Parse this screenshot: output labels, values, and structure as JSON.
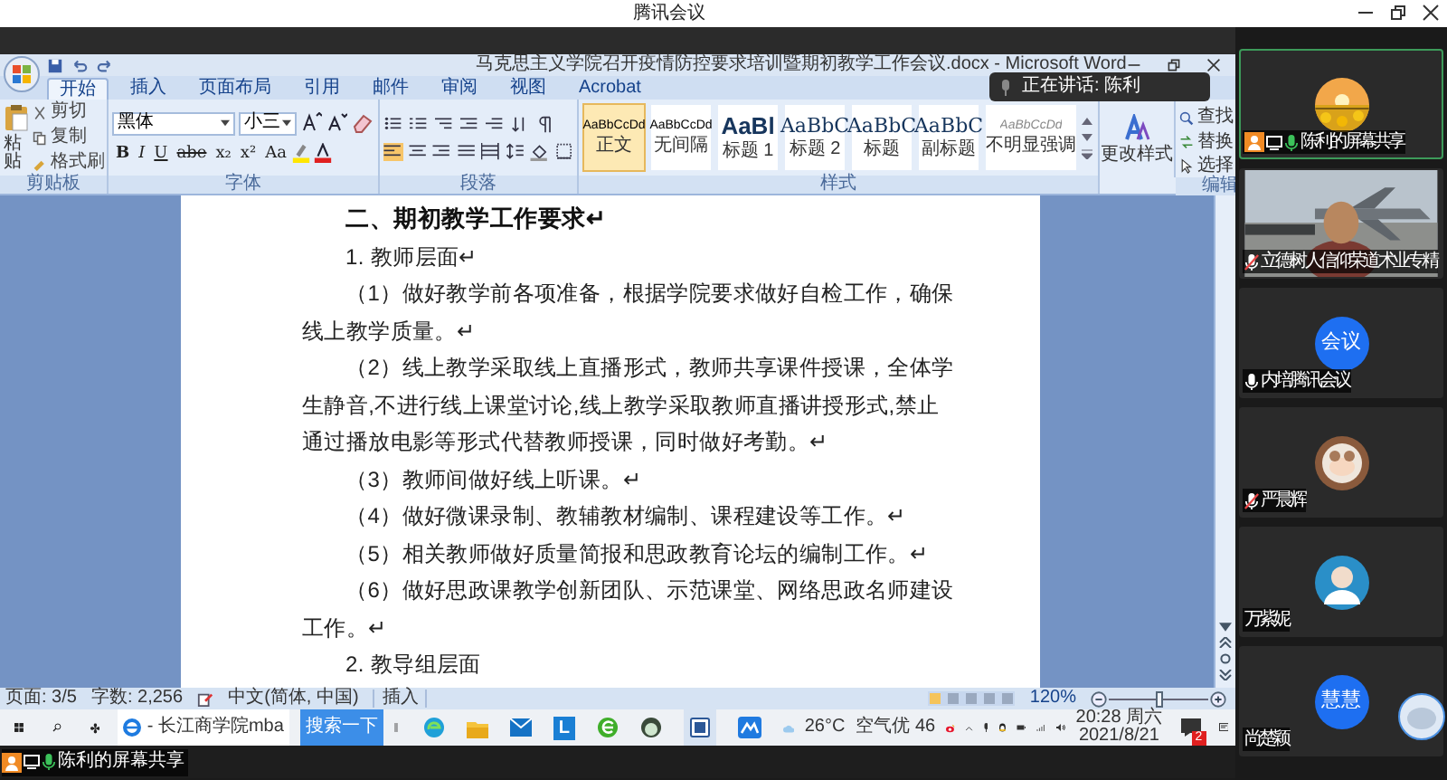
{
  "meeting": {
    "title": "腾讯会议"
  },
  "word": {
    "title": "马克思主义学院召开疫情防控要求培训暨期初教学工作会议.docx - Microsoft Word",
    "tabs": [
      {
        "label": "开始",
        "selected": true
      },
      {
        "label": "插入",
        "selected": false
      },
      {
        "label": "页面布局",
        "selected": false
      },
      {
        "label": "引用",
        "selected": false
      },
      {
        "label": "邮件",
        "selected": false
      },
      {
        "label": "审阅",
        "selected": false
      },
      {
        "label": "视图",
        "selected": false
      },
      {
        "label": "Acrobat",
        "selected": false
      }
    ],
    "clipboard": {
      "paste": "粘贴",
      "items": [
        "剪切",
        "复制",
        "格式刷"
      ],
      "group": "剪贴板"
    },
    "font": {
      "name": "黑体",
      "size": "小三",
      "buttons": [
        "B",
        "I",
        "U",
        "abe",
        "x₂",
        "x²",
        "Aa"
      ],
      "group": "字体"
    },
    "paragraph": {
      "group": "段落"
    },
    "styles": {
      "items": [
        {
          "sample": "AaBbCcDd",
          "label": "正文",
          "selected": true
        },
        {
          "sample": "AaBbCcDd",
          "label": "无间隔",
          "selected": false
        },
        {
          "sample": "AaBl",
          "label": "标题 1",
          "selected": false
        },
        {
          "sample": "AaBbC",
          "label": "标题 2",
          "selected": false
        },
        {
          "sample": "AaBbC",
          "label": "标题",
          "selected": false
        },
        {
          "sample": "AaBbC",
          "label": "副标题",
          "selected": false
        },
        {
          "sample": "AaBbCcDd",
          "label": "不明显强调",
          "selected": false
        }
      ],
      "change": "更改样式",
      "group": "样式"
    },
    "editing": {
      "items": [
        "查找",
        "替换",
        "选择"
      ],
      "group": "编辑"
    },
    "document": {
      "paragraphs": [
        {
          "kind": "heading",
          "text": "二、期初教学工作要求↵"
        },
        {
          "kind": "body",
          "text": "1. 教师层面↵"
        },
        {
          "kind": "body",
          "text": "（1）做好教学前各项准备，根据学院要求做好自检工作，确保线上教学质量。↵"
        },
        {
          "kind": "body",
          "text": "（2）线上教学采取线上直播形式，教师共享课件授课，全体学生静音,不进行线上课堂讨论,线上教学采取教师直播讲授形式,禁止通过播放电影等形式代替教师授课，同时做好考勤。↵"
        },
        {
          "kind": "body",
          "text": "（3）教师间做好线上听课。↵"
        },
        {
          "kind": "body",
          "text": "（4）做好微课录制、教辅教材编制、课程建设等工作。↵"
        },
        {
          "kind": "body",
          "text": "（5）相关教师做好质量简报和思政教育论坛的编制工作。↵"
        },
        {
          "kind": "body",
          "text": "（6）做好思政课教学创新团队、示范课堂、网络思政名师建设工作。↵"
        },
        {
          "kind": "body",
          "text": "2. 教导组层面"
        }
      ]
    },
    "status_bar": {
      "page": "页面: 3/5",
      "words": "字数: 2,256",
      "language": "中文(简体, 中国)",
      "mode": "插入",
      "zoom": "120%",
      "zoom_slider": {
        "level": 0.5
      }
    }
  },
  "speaking": {
    "label": "正在讲话: 陈利"
  },
  "taskbar": {
    "browser_address": "- 长江商学院mba",
    "search_button": "搜索一下",
    "app_letter": "L",
    "weather": "26°C",
    "air": "空气优 46",
    "time": "20:28 周六",
    "date": "2021/8/21",
    "notifications": "2"
  },
  "participants": [
    {
      "name": "陈利的屏幕共享",
      "mic_shown": true,
      "muted": false,
      "speaking": true,
      "sharing": true,
      "highlighted": true
    },
    {
      "name": "立德树人信仰荣道术业专精",
      "kind": "video",
      "mic_shown": true,
      "muted": true,
      "speaking": false,
      "sharing": false,
      "highlighted": false
    },
    {
      "name": "内培腾讯会议",
      "kind": "initials",
      "avatar_text": "会议",
      "mic_shown": true,
      "muted": false,
      "speaking": false,
      "sharing": false,
      "highlighted": false
    },
    {
      "name": "严晨辉",
      "mic_shown": true,
      "muted": true,
      "speaking": false,
      "sharing": false,
      "highlighted": false
    },
    {
      "name": "万紫妮",
      "kind": "avatar",
      "mic_shown": false,
      "sharing": false,
      "highlighted": false
    },
    {
      "name": "尚楚颖",
      "kind": "initials",
      "avatar_text": "慧慧",
      "mic_shown": false,
      "sharing": false,
      "highlighted": false
    }
  ],
  "share_bar": {
    "label": "陈利的屏幕共享",
    "speaking": true
  }
}
